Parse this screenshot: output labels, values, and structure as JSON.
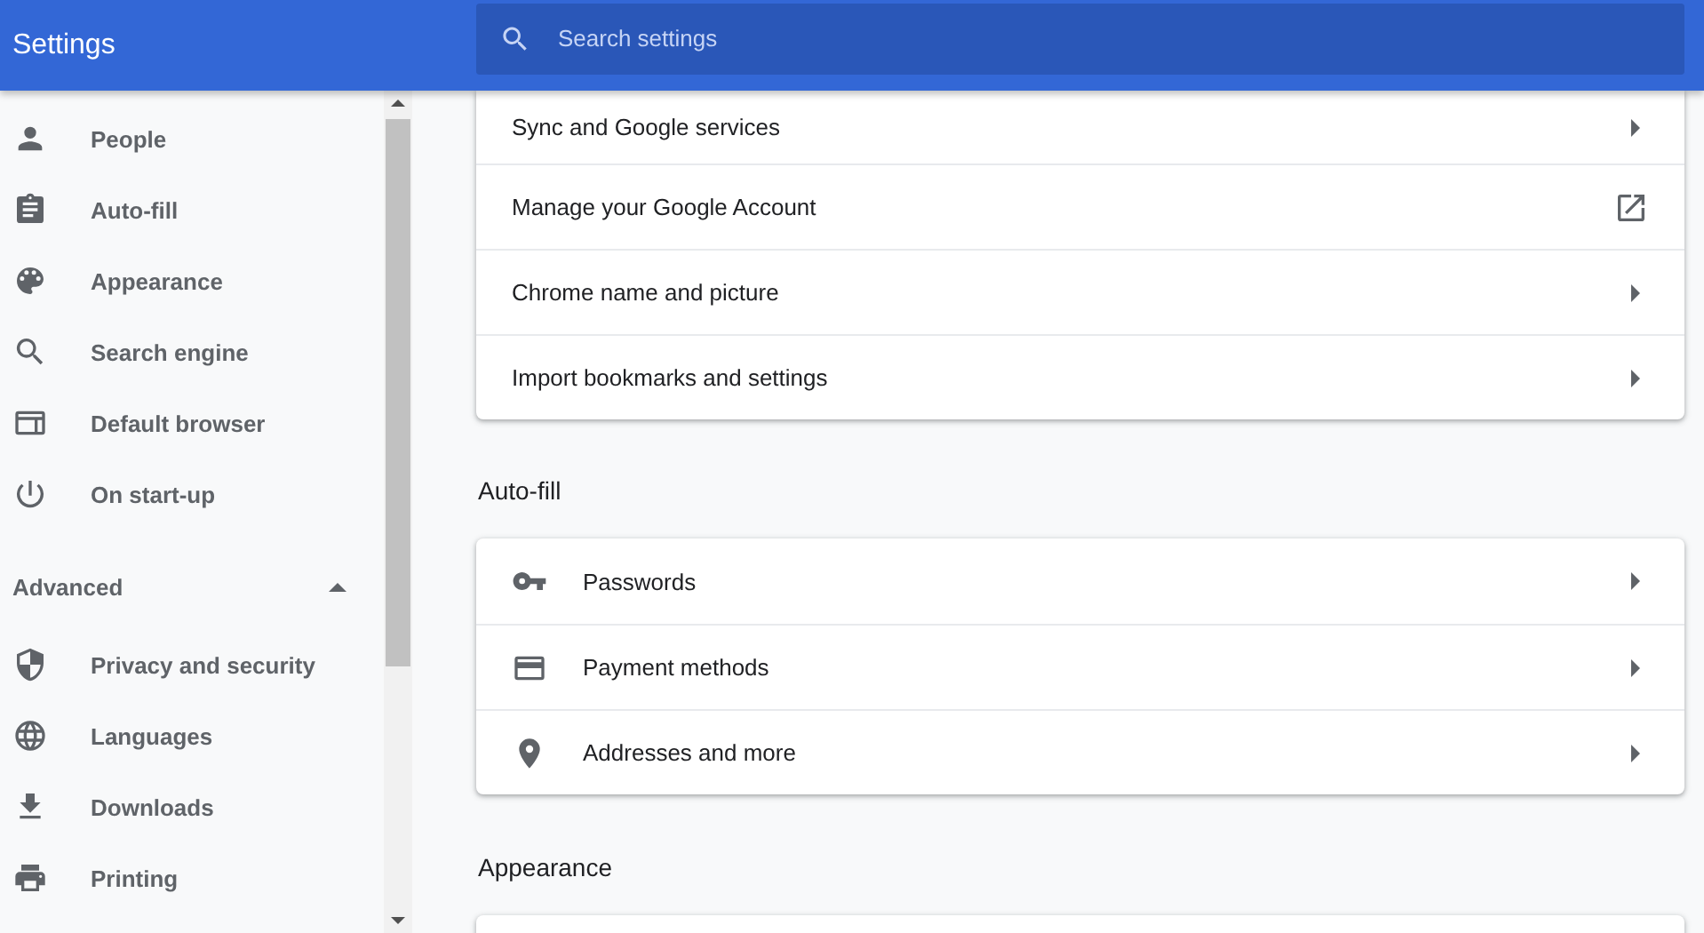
{
  "header": {
    "title": "Settings",
    "search": {
      "placeholder": "Search settings"
    }
  },
  "sidebar": {
    "items": [
      {
        "label": "People",
        "selected": false
      },
      {
        "label": "Auto-fill",
        "selected": false
      },
      {
        "label": "Appearance",
        "selected": false
      },
      {
        "label": "Search engine",
        "selected": false
      },
      {
        "label": "Default browser",
        "selected": false
      },
      {
        "label": "On start-up",
        "selected": false
      }
    ],
    "advanced": {
      "label": "Advanced",
      "expanded": true
    },
    "advanced_items": [
      {
        "label": "Privacy and security",
        "selected": false
      },
      {
        "label": "Languages",
        "selected": false
      },
      {
        "label": "Downloads",
        "selected": false
      },
      {
        "label": "Printing",
        "selected": false
      }
    ]
  },
  "sections": [
    {
      "rows": [
        {
          "label": "Sync and Google services",
          "kind": "arrow"
        },
        {
          "label": "Manage your Google Account",
          "kind": "external"
        },
        {
          "label": "Chrome name and picture",
          "kind": "arrow"
        },
        {
          "label": "Import bookmarks and settings",
          "kind": "arrow"
        }
      ]
    },
    {
      "heading": "Auto-fill",
      "rows": [
        {
          "label": "Passwords",
          "kind": "arrow"
        },
        {
          "label": "Payment methods",
          "kind": "arrow"
        },
        {
          "label": "Addresses and more",
          "kind": "arrow"
        }
      ]
    },
    {
      "heading": "Appearance"
    }
  ]
}
